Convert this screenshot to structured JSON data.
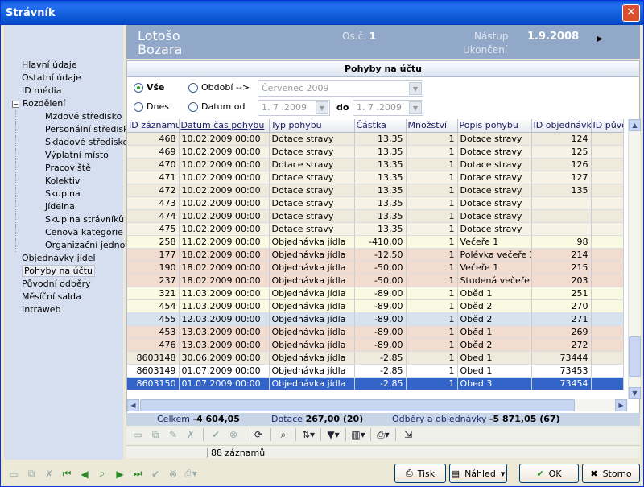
{
  "window": {
    "title": "Strávník",
    "close": "✕"
  },
  "header": {
    "first_name": "Lotošo",
    "last_name": "Bozara",
    "os_label": "Os.č.",
    "os_value": "1",
    "nastup_label": "Nástup",
    "nastup_value": "1.9.2008",
    "ukonceni_label": "Ukončení",
    "arrow": "▶"
  },
  "sidebar": {
    "items": [
      {
        "label": "Hlavní údaje",
        "level": 0
      },
      {
        "label": "Ostatní údaje",
        "level": 0
      },
      {
        "label": "ID média",
        "level": 0
      },
      {
        "label": "Rozdělení",
        "level": 0,
        "expander": "−"
      },
      {
        "label": "Mzdové středisko",
        "level": 1
      },
      {
        "label": "Personální středisko",
        "level": 1
      },
      {
        "label": "Skladové středisko",
        "level": 1
      },
      {
        "label": "Výplatní místo",
        "level": 1
      },
      {
        "label": "Pracoviště",
        "level": 1
      },
      {
        "label": "Kolektiv",
        "level": 1
      },
      {
        "label": "Skupina",
        "level": 1
      },
      {
        "label": "Jídelna",
        "level": 1
      },
      {
        "label": "Skupina strávníků",
        "level": 1
      },
      {
        "label": "Cenová kategorie",
        "level": 1
      },
      {
        "label": "Organizační jednotka",
        "level": 1
      },
      {
        "label": "Objednávky jídel",
        "level": 0
      },
      {
        "label": "Pohyby na účtu",
        "level": 0,
        "selected": true
      },
      {
        "label": "Původní odběry",
        "level": 0
      },
      {
        "label": "Měsíční salda",
        "level": 0
      },
      {
        "label": "Intraweb",
        "level": 0
      }
    ]
  },
  "panel": {
    "title": "Pohyby na účtu"
  },
  "filter": {
    "vse": "Vše",
    "obdobi": "Období -->",
    "obdobi_value": "Červenec 2009",
    "dnes": "Dnes",
    "datum_od": "Datum od",
    "od_value": "1. 7 .2009",
    "do_label": "do",
    "do_value": "1. 7 .2009"
  },
  "table": {
    "columns": [
      "ID záznamu",
      "Datum čas pohybu",
      "Typ pohybu",
      "Částka",
      "Množství",
      "Popis pohybu",
      "ID objednávky",
      "ID původ"
    ],
    "rows": [
      [
        "468",
        "10.02.2009 00:00",
        "Dotace stravy",
        "13,35",
        "1",
        "Dotace stravy",
        "124",
        ""
      ],
      [
        "469",
        "10.02.2009 00:00",
        "Dotace stravy",
        "13,35",
        "1",
        "Dotace stravy",
        "125",
        ""
      ],
      [
        "470",
        "10.02.2009 00:00",
        "Dotace stravy",
        "13,35",
        "1",
        "Dotace stravy",
        "126",
        ""
      ],
      [
        "471",
        "10.02.2009 00:00",
        "Dotace stravy",
        "13,35",
        "1",
        "Dotace stravy",
        "127",
        ""
      ],
      [
        "472",
        "10.02.2009 00:00",
        "Dotace stravy",
        "13,35",
        "1",
        "Dotace stravy",
        "135",
        ""
      ],
      [
        "473",
        "10.02.2009 00:00",
        "Dotace stravy",
        "13,35",
        "1",
        "Dotace stravy",
        "",
        ""
      ],
      [
        "474",
        "10.02.2009 00:00",
        "Dotace stravy",
        "13,35",
        "1",
        "Dotace stravy",
        "",
        ""
      ],
      [
        "475",
        "10.02.2009 00:00",
        "Dotace stravy",
        "13,35",
        "1",
        "Dotace stravy",
        "",
        ""
      ],
      [
        "258",
        "11.02.2009 00:00",
        "Objednávka jídla",
        "-410,00",
        "1",
        "Večeře 1",
        "98",
        ""
      ],
      [
        "177",
        "18.02.2009 00:00",
        "Objednávka jídla",
        "-12,50",
        "1",
        "Polévka večeře 1",
        "214",
        ""
      ],
      [
        "190",
        "18.02.2009 00:00",
        "Objednávka jídla",
        "-50,00",
        "1",
        "Večeře 1",
        "215",
        ""
      ],
      [
        "237",
        "18.02.2009 00:00",
        "Objednávka jídla",
        "-50,00",
        "1",
        "Studená večeře 1",
        "203",
        ""
      ],
      [
        "321",
        "11.03.2009 00:00",
        "Objednávka jídla",
        "-89,00",
        "1",
        "Oběd 1",
        "251",
        ""
      ],
      [
        "454",
        "11.03.2009 00:00",
        "Objednávka jídla",
        "-89,00",
        "1",
        "Oběd 2",
        "270",
        ""
      ],
      [
        "455",
        "12.03.2009 00:00",
        "Objednávka jídla",
        "-89,00",
        "1",
        "Oběd 2",
        "271",
        ""
      ],
      [
        "453",
        "13.03.2009 00:00",
        "Objednávka jídla",
        "-89,00",
        "1",
        "Oběd 1",
        "269",
        ""
      ],
      [
        "476",
        "13.03.2009 00:00",
        "Objednávka jídla",
        "-89,00",
        "1",
        "Oběd 2",
        "272",
        ""
      ],
      [
        "8603148",
        "30.06.2009 00:00",
        "Objednávka jídla",
        "-2,85",
        "1",
        "Obed 1",
        "73444",
        ""
      ],
      [
        "8603149",
        "01.07.2009 00:00",
        "Objednávka jídla",
        "-2,85",
        "1",
        "Obed 1",
        "73453",
        ""
      ],
      [
        "8603150",
        "01.07.2009 00:00",
        "Objednávka jídla",
        "-2,85",
        "1",
        "Obed 3",
        "73454",
        ""
      ]
    ],
    "row_colors": [
      "c0",
      "c1",
      "c0",
      "c1",
      "c0",
      "c1",
      "c0",
      "c1",
      "c3",
      "c2",
      "c2",
      "c2",
      "c3",
      "c3",
      "c4",
      "c2",
      "c2",
      "c0",
      "c5",
      "sel"
    ]
  },
  "totals": {
    "celkem_label": "Celkem",
    "celkem_value": "-4 604,05",
    "dotace_label": "Dotace",
    "dotace_value": "267,00 (20)",
    "odbery_label": "Odběry a objednávky",
    "odbery_value": "-5 871,05 (67)"
  },
  "status": {
    "count": "88 záznamů"
  },
  "buttons": {
    "tisk": "Tisk",
    "nahled": "Náhled",
    "ok": "OK",
    "storno": "Storno"
  }
}
